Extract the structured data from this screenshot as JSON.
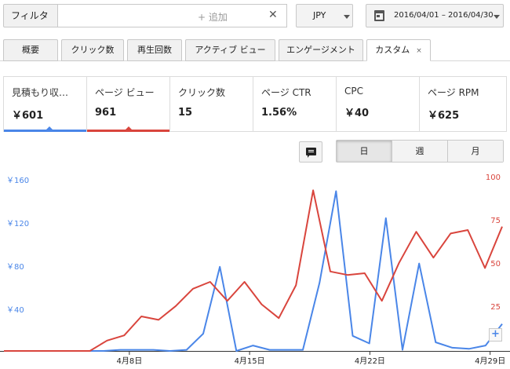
{
  "filter": {
    "label": "フィルタ",
    "add_placeholder": "+ 追加",
    "clear_glyph": "✕"
  },
  "currency": {
    "label": "JPY"
  },
  "date_range": {
    "label": "2016/04/01 – 2016/04/30"
  },
  "tabs": [
    {
      "label": "概要"
    },
    {
      "label": "クリック数"
    },
    {
      "label": "再生回数"
    },
    {
      "label": "アクティブ ビュー"
    },
    {
      "label": "エンゲージメント"
    },
    {
      "label": "カスタム",
      "active": true,
      "close": "×"
    }
  ],
  "metrics": [
    {
      "label": "見積もり収…",
      "value": "￥601",
      "color": "#4a86e8"
    },
    {
      "label": "ページ ビュー",
      "value": "961",
      "color": "#d9453d"
    },
    {
      "label": "クリック数",
      "value": "15"
    },
    {
      "label": "ページ CTR",
      "value": "1.56%"
    },
    {
      "label": "CPC",
      "value": "￥40"
    },
    {
      "label": "ページ RPM",
      "value": "￥625"
    }
  ],
  "range_buttons": [
    {
      "label": "日",
      "active": true
    },
    {
      "label": "週"
    },
    {
      "label": "月"
    }
  ],
  "zoom_button": {
    "label": "+"
  },
  "chart_data": {
    "type": "line",
    "x_dates": [
      "2016/04/01",
      "2016/04/02",
      "2016/04/03",
      "2016/04/04",
      "2016/04/05",
      "2016/04/06",
      "2016/04/07",
      "2016/04/08",
      "2016/04/09",
      "2016/04/10",
      "2016/04/11",
      "2016/04/12",
      "2016/04/13",
      "2016/04/14",
      "2016/04/15",
      "2016/04/16",
      "2016/04/17",
      "2016/04/18",
      "2016/04/19",
      "2016/04/20",
      "2016/04/21",
      "2016/04/22",
      "2016/04/23",
      "2016/04/24",
      "2016/04/25",
      "2016/04/26",
      "2016/04/27",
      "2016/04/28",
      "2016/04/29",
      "2016/04/30"
    ],
    "x_tick_labels": [
      {
        "date": "2016/04/08",
        "label": "4月8日"
      },
      {
        "date": "2016/04/15",
        "label": "4月15日"
      },
      {
        "date": "2016/04/22",
        "label": "4月22日"
      },
      {
        "date": "2016/04/29",
        "label": "4月29日"
      }
    ],
    "y_left": {
      "ticks": [
        "￥40",
        "￥80",
        "￥120",
        "￥160"
      ],
      "tick_values": [
        40,
        80,
        120,
        160
      ],
      "range": [
        0,
        160
      ],
      "color": "#4a86e8"
    },
    "y_right": {
      "ticks": [
        "25",
        "50",
        "75",
        "100"
      ],
      "tick_values": [
        25,
        50,
        75,
        100
      ],
      "range": [
        0,
        100
      ],
      "color": "#d9453d"
    },
    "series": [
      {
        "axis": "left",
        "color": "#4a86e8",
        "values": [
          0,
          0,
          0,
          0,
          0,
          0,
          0,
          1,
          1,
          1,
          0,
          1,
          16,
          78,
          0,
          5,
          1,
          1,
          1,
          63,
          148,
          14,
          7,
          123,
          1,
          81,
          8,
          3,
          2,
          5,
          25
        ]
      },
      {
        "axis": "right",
        "color": "#d9453d",
        "values": [
          0,
          0,
          0,
          0,
          0,
          0,
          6,
          9,
          20,
          18,
          26,
          36,
          40,
          29,
          40,
          27,
          19,
          38,
          93,
          46,
          44,
          45,
          29,
          51,
          69,
          54,
          68,
          70,
          48,
          72
        ]
      }
    ],
    "grid": false
  }
}
